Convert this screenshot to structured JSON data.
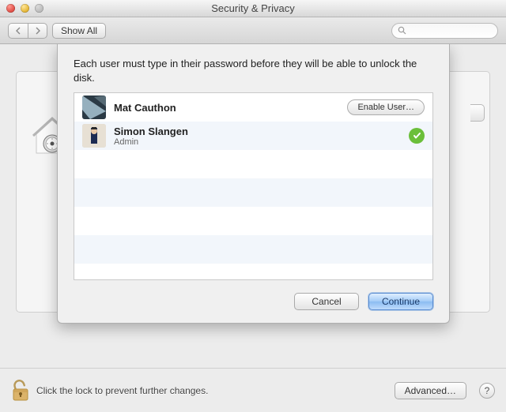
{
  "window": {
    "title": "Security & Privacy"
  },
  "toolbar": {
    "show_all_label": "Show All",
    "search_placeholder": ""
  },
  "sheet": {
    "message": "Each user must type in their password before they will be able to unlock the disk.",
    "users": [
      {
        "name": "Mat Cauthon",
        "role": "",
        "enabled": false,
        "action_label": "Enable User…"
      },
      {
        "name": "Simon Slangen",
        "role": "Admin",
        "enabled": true,
        "action_label": ""
      }
    ],
    "cancel_label": "Cancel",
    "continue_label": "Continue"
  },
  "footer": {
    "lock_text": "Click the lock to prevent further changes.",
    "advanced_label": "Advanced…",
    "help_label": "?"
  }
}
